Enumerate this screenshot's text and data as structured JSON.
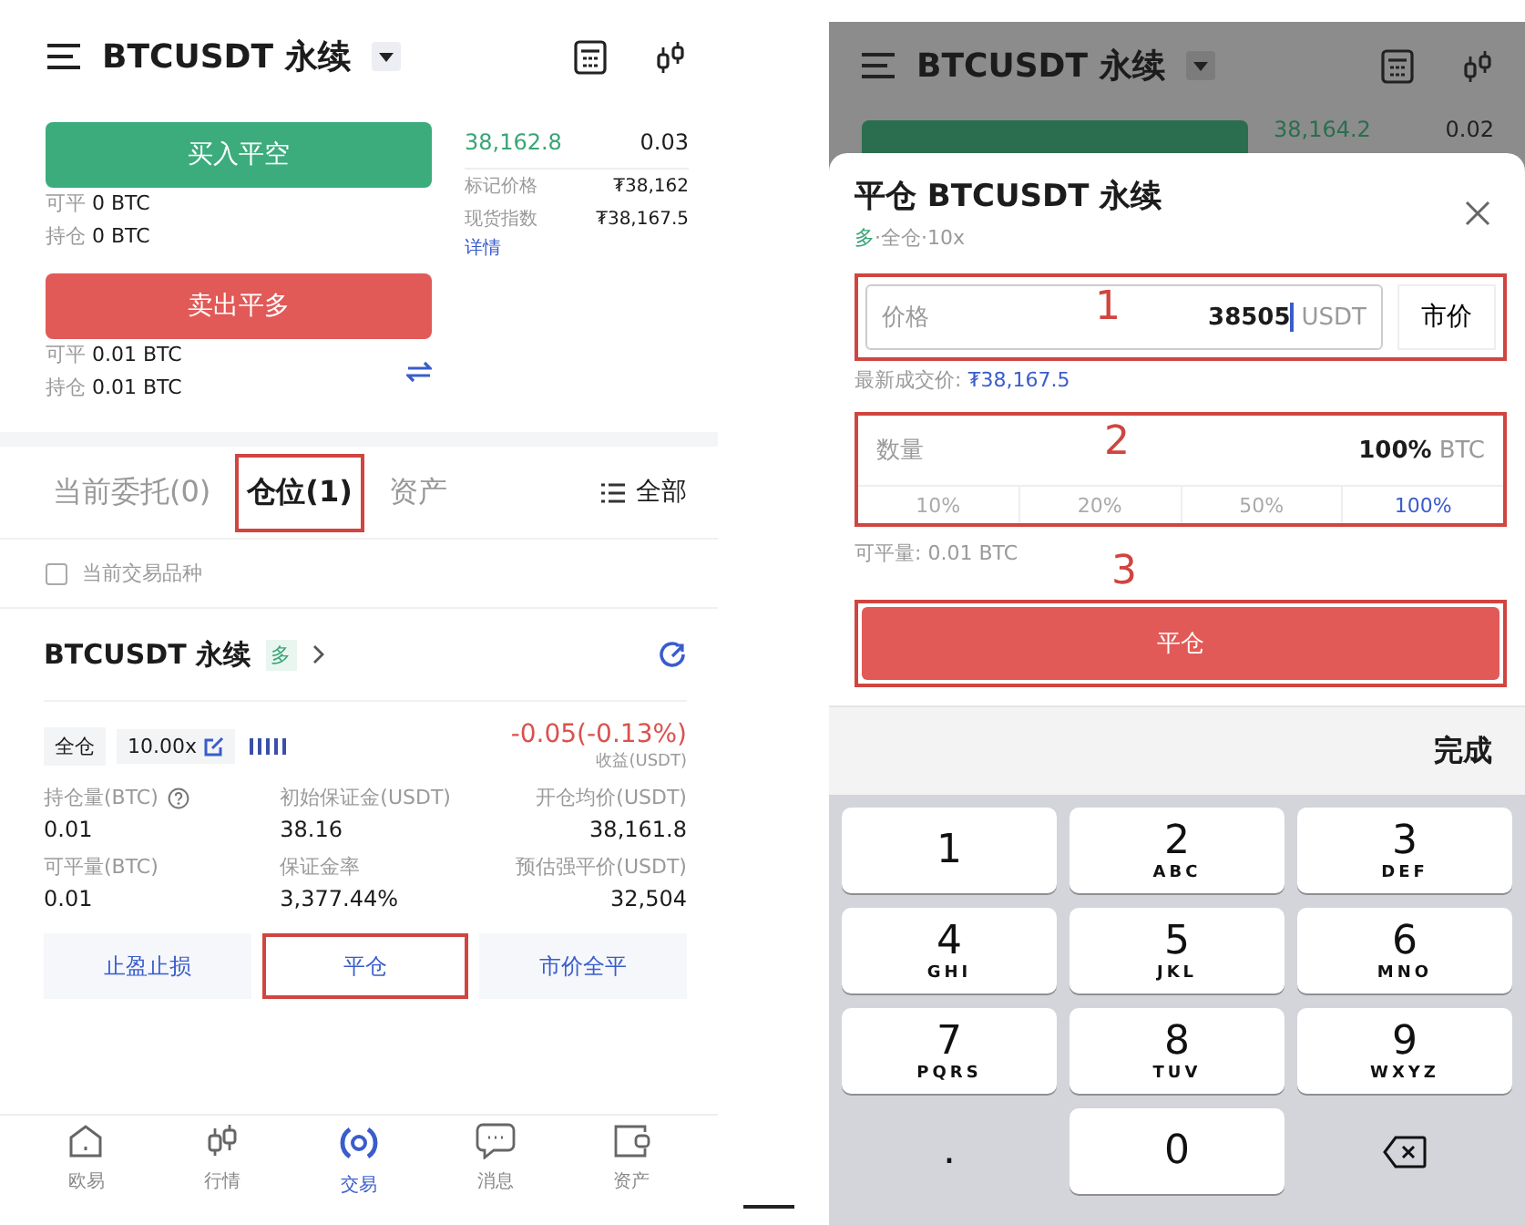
{
  "left_screen": {
    "header": {
      "title": "BTCUSDT 永续"
    },
    "order_panel": {
      "buy_button": "买入平空",
      "buy_info": [
        {
          "label": "可平",
          "value": "0 BTC"
        },
        {
          "label": "持仓",
          "value": "0 BTC"
        }
      ],
      "sell_button": "卖出平多",
      "sell_info": [
        {
          "label": "可平",
          "value": "0.01 BTC"
        },
        {
          "label": "持仓",
          "value": "0.01 BTC"
        }
      ]
    },
    "order_book": {
      "last_row": {
        "price": "38,162.8",
        "amount": "0.03"
      },
      "stats": [
        {
          "label": "标记价格",
          "value": "₮38,162"
        },
        {
          "label": "现货指数",
          "value": "₮38,167.5"
        }
      ],
      "details_link": "详情"
    },
    "tabs": [
      {
        "label": "当前委托(0)",
        "selected": false,
        "highlighted": false
      },
      {
        "label": "仓位(1)",
        "selected": true,
        "highlighted": true
      },
      {
        "label": "资产",
        "selected": false,
        "highlighted": false
      }
    ],
    "filter": "全部",
    "symbol_filter": {
      "label": "当前交易品种",
      "checked": false
    },
    "position": {
      "title": "BTCUSDT 永续",
      "side": "多",
      "margin_mode": "全仓",
      "leverage": "10.00x",
      "pnl": "-0.05(-0.13%)",
      "pnl_label": "收益(USDT)",
      "fields": [
        {
          "label": "持仓量(BTC)",
          "value": "0.01",
          "help": true
        },
        {
          "label": "初始保证金(USDT)",
          "value": "38.16"
        },
        {
          "label": "开仓均价(USDT)",
          "value": "38,161.8"
        },
        {
          "label": "可平量(BTC)",
          "value": "0.01"
        },
        {
          "label": "保证金率",
          "value": "3,377.44%"
        },
        {
          "label": "预估强平价(USDT)",
          "value": "32,504"
        }
      ],
      "actions": [
        {
          "label": "止盈止损",
          "highlighted": false
        },
        {
          "label": "平仓",
          "highlighted": true
        },
        {
          "label": "市价全平",
          "highlighted": false
        }
      ]
    },
    "bottom_nav": [
      {
        "label": "欧易",
        "kind": "home",
        "selected": false
      },
      {
        "label": "行情",
        "kind": "market",
        "selected": false
      },
      {
        "label": "交易",
        "kind": "trade",
        "selected": true
      },
      {
        "label": "消息",
        "kind": "chat",
        "selected": false
      },
      {
        "label": "资产",
        "kind": "wallet",
        "selected": false
      }
    ]
  },
  "right_screen": {
    "header": {
      "title": "BTCUSDT 永续"
    },
    "background_row": {
      "price": "38,164.2",
      "amount": "0.02"
    },
    "close_sheet": {
      "title": "平仓 BTCUSDT 永续",
      "side": "多",
      "subtitle": "·全仓·10x",
      "price": {
        "label": "价格",
        "value": "38505",
        "unit": "USDT",
        "marker": "1"
      },
      "market_button": "市价",
      "last_price": {
        "label": "最新成交价:",
        "value": "₮38,167.5"
      },
      "quantity": {
        "label": "数量",
        "value": "100%",
        "unit": "BTC",
        "marker": "2",
        "options": [
          {
            "label": "10%",
            "selected": false
          },
          {
            "label": "20%",
            "selected": false
          },
          {
            "label": "50%",
            "selected": false
          },
          {
            "label": "100%",
            "selected": true
          }
        ]
      },
      "available": "可平量: 0.01 BTC",
      "confirm": {
        "label": "平仓",
        "marker": "3"
      }
    },
    "keyboard": {
      "done": "完成",
      "keys": [
        {
          "kind": "digit",
          "digit": "1"
        },
        {
          "kind": "digit",
          "digit": "2",
          "letters": "ABC"
        },
        {
          "kind": "digit",
          "digit": "3",
          "letters": "DEF"
        },
        {
          "kind": "digit",
          "digit": "4",
          "letters": "GHI"
        },
        {
          "kind": "digit",
          "digit": "5",
          "letters": "JKL"
        },
        {
          "kind": "digit",
          "digit": "6",
          "letters": "MNO"
        },
        {
          "kind": "digit",
          "digit": "7",
          "letters": "PQRS"
        },
        {
          "kind": "digit",
          "digit": "8",
          "letters": "TUV"
        },
        {
          "kind": "digit",
          "digit": "9",
          "letters": "WXYZ"
        },
        {
          "kind": "symbol",
          "digit": "."
        },
        {
          "kind": "digit",
          "digit": "0"
        },
        {
          "kind": "delete"
        }
      ]
    }
  }
}
